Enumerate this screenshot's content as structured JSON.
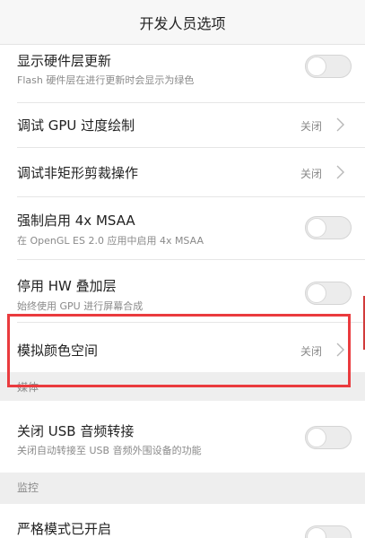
{
  "header": {
    "title": "开发人员选项"
  },
  "items": {
    "hw_layers": {
      "title": "显示硬件层更新",
      "subtitle": "Flash 硬件层在进行更新时会显示为绿色"
    },
    "gpu_overdraw": {
      "title": "调试 GPU 过度绘制",
      "value": "关闭"
    },
    "nonrect_clip": {
      "title": "调试非矩形剪裁操作",
      "value": "关闭"
    },
    "force_msaa": {
      "title": "强制启用 4x MSAA",
      "subtitle": "在 OpenGL ES 2.0 应用中启用 4x MSAA"
    },
    "disable_hw_overlay": {
      "title": "停用 HW 叠加层",
      "subtitle": "始终使用 GPU 进行屏幕合成"
    },
    "simulate_color": {
      "title": "模拟颜色空间",
      "value": "关闭"
    },
    "disable_usb_audio": {
      "title": "关闭 USB 音频转接",
      "subtitle": "关闭自动转接至 USB 音频外围设备的功能"
    },
    "strict_mode": {
      "title": "严格模式已开启"
    }
  },
  "sections": {
    "media": "媒体",
    "monitoring": "监控"
  },
  "colors": {
    "highlight": "#ea3b3e",
    "section_bg": "#eeeeee",
    "secondary_text": "#8a8a8a"
  }
}
